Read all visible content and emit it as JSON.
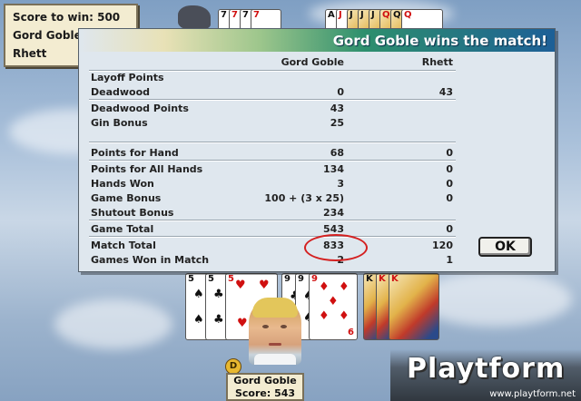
{
  "score_panel": {
    "score_to_win": "Score to win: 500",
    "player1": "Gord Goble",
    "player2": "Rhett"
  },
  "opponent_hand": {
    "group1": [
      "7",
      "7",
      "7",
      "7"
    ],
    "group2": [
      "A",
      "J",
      "Q"
    ]
  },
  "dialog": {
    "title": "Gord Goble wins the match!",
    "col_player1": "Gord Goble",
    "col_player2": "Rhett",
    "rows": [
      {
        "label": "Layoff Points",
        "p1": "",
        "p2": ""
      },
      {
        "label": "Deadwood",
        "p1": "0",
        "p2": "43"
      },
      {
        "label": "Deadwood Points",
        "p1": "43",
        "p2": ""
      },
      {
        "label": "Gin Bonus",
        "p1": "25",
        "p2": ""
      },
      {
        "label": "Points for Hand",
        "p1": "68",
        "p2": "0"
      },
      {
        "label": "Points for All Hands",
        "p1": "134",
        "p2": "0"
      },
      {
        "label": "Hands Won",
        "p1": "3",
        "p2": "0"
      },
      {
        "label": "Game Bonus",
        "p1": "100 + (3 x 25)",
        "p2": "0"
      },
      {
        "label": "Shutout Bonus",
        "p1": "234",
        "p2": ""
      },
      {
        "label": "Game Total",
        "p1": "543",
        "p2": "0"
      },
      {
        "label": "Match Total",
        "p1": "833",
        "p2": "120"
      },
      {
        "label": "Games Won in Match",
        "p1": "2",
        "p2": "1"
      }
    ],
    "ok_label": "OK"
  },
  "player_hand": {
    "group1": [
      "5",
      "5",
      "5"
    ],
    "group2": [
      "9",
      "9",
      "9",
      "6"
    ],
    "group3": [
      "K",
      "K",
      "K"
    ]
  },
  "player_badge": {
    "dealer": "D",
    "name": "Gord Goble",
    "score": "Score: 543"
  },
  "watermark": {
    "logo": "Playtform",
    "url": "www.playtform.net"
  },
  "colors": {
    "suit_red": "#d01010",
    "match_total_circle": "#d42020",
    "title_text": "#ffffff"
  }
}
